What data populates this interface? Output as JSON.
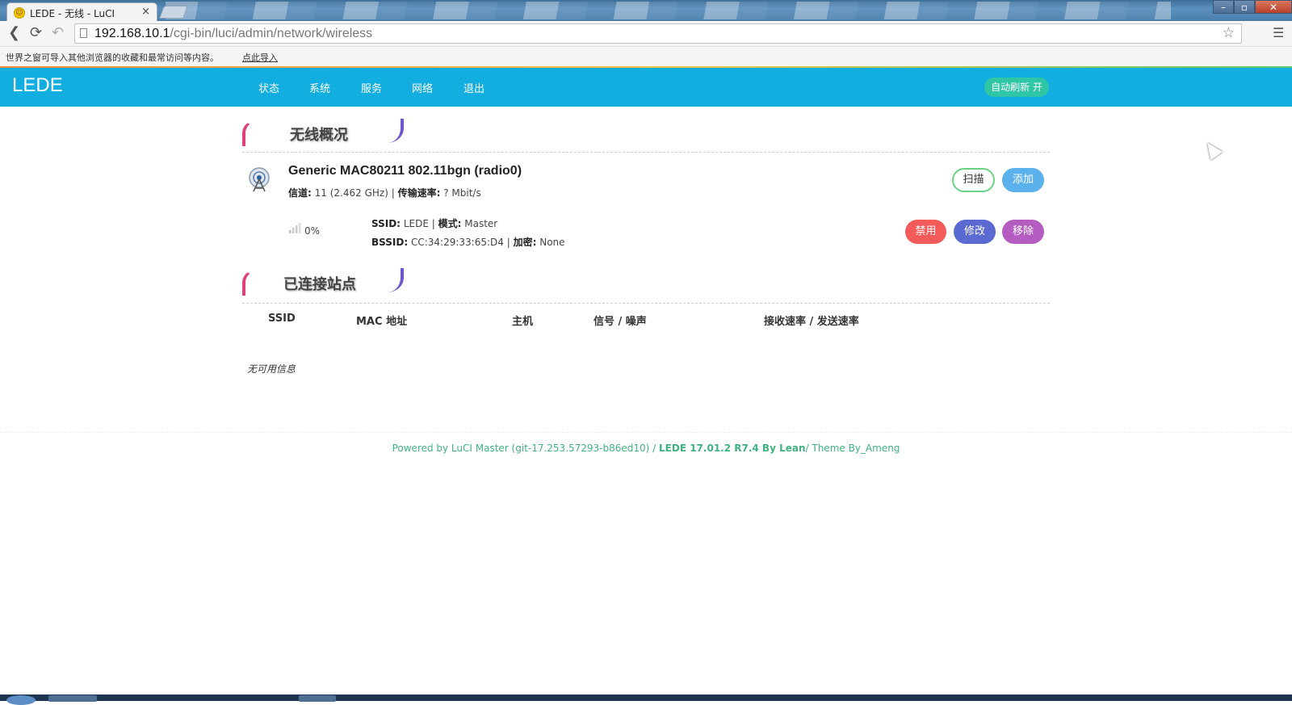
{
  "browser": {
    "tab_title": "LEDE - 无线 - LuCI",
    "tab_close": "×",
    "url_host": "192.168.10.1",
    "url_path": "/cgi-bin/luci/admin/network/wireless",
    "infobar_message": "世界之窗可导入其他浏览器的收藏和最常访问等内容。",
    "infobar_link": "点此导入",
    "window_controls": {
      "minimize": "–",
      "restore": "▫",
      "close": "✕"
    }
  },
  "navbar": {
    "brand": "LEDE",
    "items": [
      "状态",
      "系统",
      "服务",
      "网络",
      "退出"
    ],
    "auto_refresh": "自动刷新 开"
  },
  "wireless_overview": {
    "title": "无线概况",
    "radio": {
      "name": "Generic MAC80211 802.11bgn (radio0)",
      "channel_label": "信道:",
      "channel_value": "11 (2.462 GHz)",
      "rate_label": "传输速率:",
      "rate_value": "? Mbit/s",
      "sep": "|"
    },
    "buttons": {
      "scan": "扫描",
      "add": "添加",
      "disable": "禁用",
      "edit": "修改",
      "remove": "移除"
    },
    "network": {
      "signal_percent": "0%",
      "ssid_label": "SSID:",
      "ssid_value": "LEDE",
      "mode_label": "模式:",
      "mode_value": "Master",
      "bssid_label": "BSSID:",
      "bssid_value": "CC:34:29:33:65:D4",
      "encryption_label": "加密:",
      "encryption_value": "None",
      "sep": "|"
    }
  },
  "stations": {
    "title": "已连接站点",
    "columns": [
      "SSID",
      "MAC 地址",
      "主机",
      "信号 / 噪声",
      "接收速率 / 发送速率"
    ],
    "empty": "无可用信息"
  },
  "footer": {
    "powered": "Powered by LuCI Master (git-17.253.57293-b86ed10) / ",
    "lede_version": "LEDE 17.01.2 R7.4 By Lean",
    "theme": "/ Theme By_Ameng"
  },
  "colors": {
    "navbar": "#13aee0",
    "auto_refresh": "#2ec6a5",
    "scan_border": "#69d384",
    "add": "#5ab1ec",
    "disable": "#f35a5a",
    "edit": "#5b6ad0",
    "remove": "#b45cc0",
    "footer_text": "#3fb37f"
  },
  "icons": {
    "favicon": "lede-favicon-icon",
    "back": "back-arrow-icon",
    "reload": "reload-icon",
    "undo": "undo-icon",
    "page": "page-icon",
    "bookmark": "star-icon",
    "menu": "menu-icon",
    "radio": "wireless-antenna-icon",
    "signal": "signal-bars-icon"
  }
}
